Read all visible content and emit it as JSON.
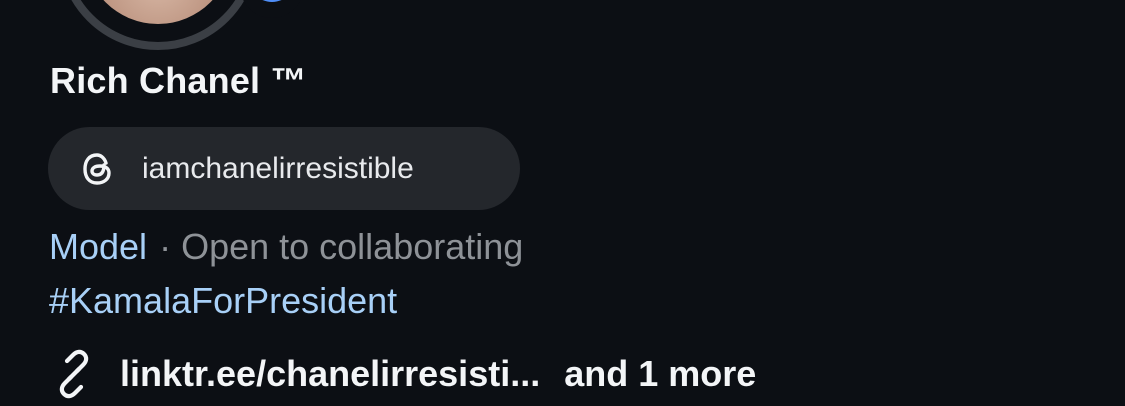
{
  "profile": {
    "name": "Rich Chanel ™",
    "threads_handle": "iamchanelirresistible",
    "category": "Model",
    "separator": "·",
    "status": "Open to collaborating",
    "hashtag": "#KamalaForPresident",
    "link_text": "linktr.ee/chanelirresisti...",
    "link_more": "and 1 more"
  },
  "icons": {
    "threads": "threads-icon",
    "link": "link-icon",
    "badge": "add-badge-icon"
  },
  "colors": {
    "background": "#0c0f14",
    "pill": "#24272c",
    "accent_link": "#a8d0f7",
    "muted": "#8e9297",
    "badge": "#4f8ef7"
  }
}
